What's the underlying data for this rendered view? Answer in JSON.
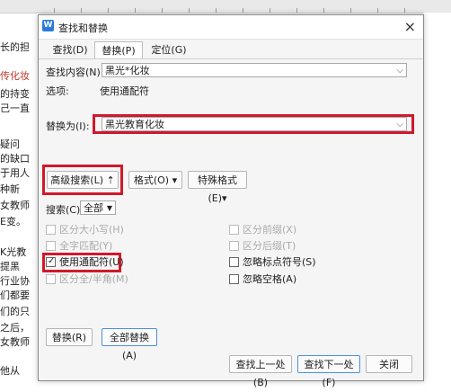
{
  "doc": {
    "lines": [
      "长的担",
      "传化妆",
      "的持变",
      "己一直",
      "疑问",
      "的缺口",
      "于用人",
      "种新",
      "女教师",
      "E变。",
      "K光教",
      "提黑",
      "行业协",
      "们都要",
      "们的只",
      "之后，",
      "女教师",
      "他从"
    ]
  },
  "dialog": {
    "title": "查找和替换",
    "tabs": [
      "查找(D)",
      "替换(P)",
      "定位(G)"
    ],
    "find": {
      "label": "查找内容(N):",
      "value": "黑光*化妆"
    },
    "options": {
      "label": "选项:",
      "value": "使用通配符"
    },
    "replace": {
      "label": "替换为(I):",
      "value": "黑光教育化妆"
    },
    "buttons": {
      "advanced": "高级搜索(L) ⇡",
      "format": "格式(O) ▾",
      "special": "特殊格式(E)▾"
    },
    "search": {
      "label": "搜索(C)",
      "value": "全部"
    },
    "checkboxes": {
      "match_case": "区分大小写(H)",
      "whole_word": "全字匹配(Y)",
      "wildcards": "使用通配符(U)",
      "fullhalf": "区分全/半角(M)",
      "prefix": "区分前缀(X)",
      "suffix": "区分后缀(T)",
      "ignore_punct": "忽略标点符号(S)",
      "ignore_space": "忽略空格(A)"
    },
    "bottom": {
      "replace": "替换(R)",
      "replace_all": "全部替换(A)",
      "find_prev": "查找上一处(B)",
      "find_next": "查找下一处(F)",
      "close": "关闭"
    }
  },
  "colors": {
    "highlight": "#d0192b",
    "accent": "#2b7bd6"
  }
}
